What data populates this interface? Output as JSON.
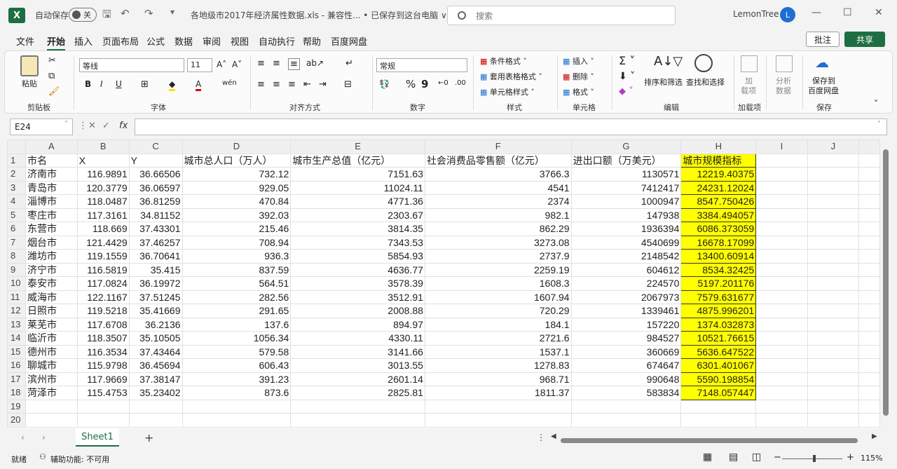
{
  "titlebar": {
    "autosave_label": "自动保存",
    "autosave_state": "关",
    "doc_title": "各地级市2017年经济属性数据.xls  -  兼容性...  •  已保存到这台电脑 ∨",
    "search_placeholder": "搜索",
    "user_name": "LemonTree",
    "avatar_letter": "L"
  },
  "menu": {
    "items": [
      "文件",
      "开始",
      "插入",
      "页面布局",
      "公式",
      "数据",
      "审阅",
      "视图",
      "自动执行",
      "帮助",
      "百度网盘"
    ],
    "active": "开始",
    "comment_label": "批注",
    "share_label": "共享"
  },
  "ribbon": {
    "paste": "粘贴",
    "font_name": "等线",
    "font_size": "11",
    "number_format": "常规",
    "conditional": "条件格式",
    "table_style": "套用表格格式",
    "cell_style": "单元格样式",
    "insert": "插入",
    "delete": "删除",
    "format": "格式",
    "sort_filter": "排序和筛选",
    "find_select": "查找和选择",
    "add_item_1": "加",
    "add_item_2": "载项",
    "analyze_1": "分析",
    "analyze_2": "数据",
    "save_baidu_1": "保存到",
    "save_baidu_2": "百度网盘",
    "groups": [
      "剪贴板",
      "字体",
      "对齐方式",
      "数字",
      "样式",
      "单元格",
      "编辑",
      "加载项",
      "保存"
    ]
  },
  "formula": {
    "name_box": "E24",
    "fx": "fx"
  },
  "sheet": {
    "columns": [
      "A",
      "B",
      "C",
      "D",
      "E",
      "F",
      "G",
      "H",
      "I",
      "J"
    ],
    "headers": [
      "市名",
      "X",
      "Y",
      "城市总人口（万人）",
      "城市生产总值（亿元）",
      "社会消费品零售额（亿元）",
      "进出口额（万美元）",
      "城市规模指标"
    ],
    "rows": [
      [
        "济南市",
        "116.9891",
        "36.66506",
        "732.12",
        "7151.63",
        "3766.3",
        "1130571",
        "12219.40375"
      ],
      [
        "青岛市",
        "120.3779",
        "36.06597",
        "929.05",
        "11024.11",
        "4541",
        "7412417",
        "24231.12024"
      ],
      [
        "淄博市",
        "118.0487",
        "36.81259",
        "470.84",
        "4771.36",
        "2374",
        "1000947",
        "8547.750426"
      ],
      [
        "枣庄市",
        "117.3161",
        "34.81152",
        "392.03",
        "2303.67",
        "982.1",
        "147938",
        "3384.494057"
      ],
      [
        "东营市",
        "118.669",
        "37.43301",
        "215.46",
        "3814.35",
        "862.29",
        "1936394",
        "6086.373059"
      ],
      [
        "烟台市",
        "121.4429",
        "37.46257",
        "708.94",
        "7343.53",
        "3273.08",
        "4540699",
        "16678.17099"
      ],
      [
        "潍坊市",
        "119.1559",
        "36.70641",
        "936.3",
        "5854.93",
        "2737.9",
        "2148542",
        "13400.60914"
      ],
      [
        "济宁市",
        "116.5819",
        "35.415",
        "837.59",
        "4636.77",
        "2259.19",
        "604612",
        "8534.32425"
      ],
      [
        "泰安市",
        "117.0824",
        "36.19972",
        "564.51",
        "3578.39",
        "1608.3",
        "224570",
        "5197.201176"
      ],
      [
        "威海市",
        "122.1167",
        "37.51245",
        "282.56",
        "3512.91",
        "1607.94",
        "2067973",
        "7579.631677"
      ],
      [
        "日照市",
        "119.5218",
        "35.41669",
        "291.65",
        "2008.88",
        "720.29",
        "1339461",
        "4875.996201"
      ],
      [
        "莱芜市",
        "117.6708",
        "36.2136",
        "137.6",
        "894.97",
        "184.1",
        "157220",
        "1374.032873"
      ],
      [
        "临沂市",
        "118.3507",
        "35.10505",
        "1056.34",
        "4330.11",
        "2721.6",
        "984527",
        "10521.76615"
      ],
      [
        "德州市",
        "116.3534",
        "37.43464",
        "579.58",
        "3141.66",
        "1537.1",
        "360669",
        "5636.647522"
      ],
      [
        "聊城市",
        "115.9798",
        "36.45694",
        "606.43",
        "3013.55",
        "1278.83",
        "674647",
        "6301.401067"
      ],
      [
        "滨州市",
        "117.9669",
        "37.38147",
        "391.23",
        "2601.14",
        "968.71",
        "990648",
        "5590.198854"
      ],
      [
        "菏泽市",
        "115.4753",
        "35.23402",
        "873.6",
        "2825.81",
        "1811.37",
        "583834",
        "7148.057447"
      ]
    ],
    "row_numbers": [
      "1",
      "2",
      "3",
      "4",
      "5",
      "6",
      "7",
      "8",
      "9",
      "10",
      "11",
      "12",
      "13",
      "14",
      "15",
      "16",
      "17",
      "18",
      "19",
      "20"
    ]
  },
  "tabs": {
    "sheet_name": "Sheet1",
    "add": "+"
  },
  "status": {
    "ready": "就绪",
    "accessibility": "辅助功能: 不可用",
    "zoom": "115%"
  },
  "colors": {
    "excel_green": "#1d6f42",
    "highlight": "#ffff00"
  }
}
